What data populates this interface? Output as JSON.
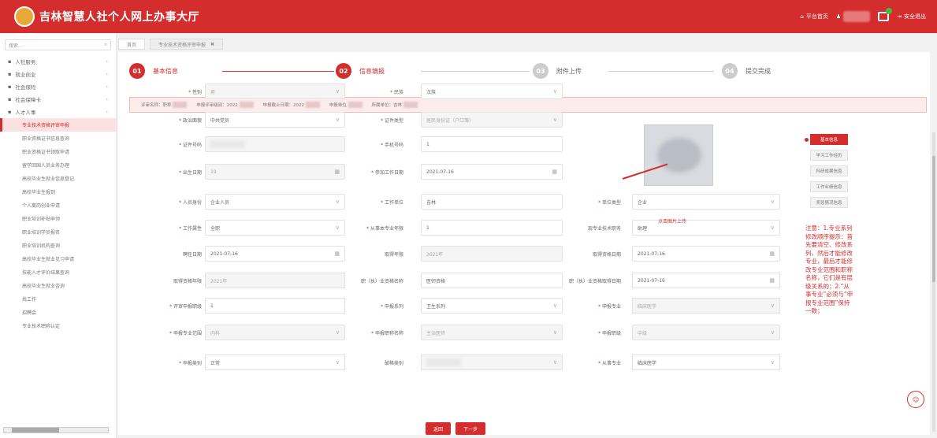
{
  "header": {
    "title": "吉林智慧人社个人网上办事大厅",
    "home_label": "平台首页",
    "logout_label": "安全退出"
  },
  "sidebar": {
    "search_placeholder": "搜索...",
    "groups": [
      {
        "label": "人社服务"
      },
      {
        "label": "就业创业"
      },
      {
        "label": "社会保险"
      },
      {
        "label": "社会保障卡"
      },
      {
        "label": "人才人事"
      }
    ],
    "sub_items": [
      {
        "label": "专业技术资格评审申报"
      },
      {
        "label": "职业资格证书信息查询"
      },
      {
        "label": "职业资格证书领取申请"
      },
      {
        "label": "留学回国人员业务办理"
      },
      {
        "label": "高校毕业生就业信息登记"
      },
      {
        "label": "高校毕业生报到"
      },
      {
        "label": "个人离岗创业申请"
      },
      {
        "label": "职业培训补贴申领"
      },
      {
        "label": "职业培训学员报名"
      },
      {
        "label": "职业培训机构查询"
      },
      {
        "label": "高校毕业生就业见习申请"
      },
      {
        "label": "技能人才评价结果查询"
      },
      {
        "label": "高校毕业生就业咨询"
      },
      {
        "label": "找工作"
      },
      {
        "label": "招聘会"
      },
      {
        "label": "专业技术职称认定"
      }
    ]
  },
  "tabs": [
    {
      "label": "首页"
    },
    {
      "label": "专业技术资格评审申报"
    }
  ],
  "steps": [
    {
      "num": "01",
      "label": "基本信息"
    },
    {
      "num": "02",
      "label": "信息填报"
    },
    {
      "num": "03",
      "label": "附件上传"
    },
    {
      "num": "04",
      "label": "提交完成"
    }
  ],
  "infobar": {
    "items": [
      "评审名称：职称",
      "申报评审级别：2022",
      "申报截止日期：2022",
      "申报单位",
      "所属单位：吉林"
    ]
  },
  "form": {
    "fields": [
      {
        "label": "性别",
        "value": "男",
        "required": true,
        "disabled": true,
        "suffix": "∨"
      },
      {
        "label": "民族",
        "value": "汉族",
        "required": true,
        "disabled": false,
        "suffix": "∨"
      },
      {
        "label": "政治面貌",
        "value": "中共党员",
        "required": true,
        "disabled": false,
        "suffix": "∨"
      },
      {
        "label": "证件类型",
        "value": "居民身份证（户口簿）",
        "required": true,
        "disabled": true,
        "suffix": "∨"
      },
      {
        "label": "证件号码",
        "value": "",
        "required": true,
        "disabled": true,
        "suffix": ""
      },
      {
        "label": "手机号码",
        "value": "1",
        "required": true,
        "disabled": false,
        "suffix": ""
      },
      {
        "label": "出生日期",
        "value": "19",
        "required": true,
        "disabled": true,
        "suffix": "▦"
      },
      {
        "label": "参加工作日期",
        "value": "2021-07-16",
        "required": true,
        "disabled": false,
        "suffix": "▦"
      },
      {
        "label": "人员身份",
        "value": "企业人员",
        "required": true,
        "disabled": false,
        "suffix": "∨"
      },
      {
        "label": "工作单位",
        "value": "吉林",
        "required": true,
        "disabled": false,
        "suffix": ""
      },
      {
        "label": "单位类型",
        "value": "企业",
        "required": true,
        "disabled": false,
        "suffix": "∨"
      },
      {
        "label": "工作属性",
        "value": "全职",
        "required": true,
        "disabled": false,
        "suffix": "∨"
      },
      {
        "label": "从事本专业年限",
        "value": "1",
        "required": true,
        "disabled": false,
        "suffix": ""
      },
      {
        "label": "现专业技术职务",
        "value": "助理",
        "required": false,
        "disabled": false,
        "suffix": "∨"
      },
      {
        "label": "聘任日期",
        "value": "2021-07-16",
        "required": false,
        "disabled": false,
        "suffix": "▦"
      },
      {
        "label": "取得年限",
        "value": "2021年",
        "required": false,
        "disabled": true,
        "suffix": ""
      },
      {
        "label": "取得资格日期",
        "value": "2021-07-16",
        "required": false,
        "disabled": false,
        "suffix": "▦"
      },
      {
        "label": "取得资格年限",
        "value": "2021年",
        "required": false,
        "disabled": true,
        "suffix": ""
      },
      {
        "label": "职（执）业资格名称",
        "value": "医师资格",
        "required": false,
        "disabled": false,
        "suffix": ""
      },
      {
        "label": "职（执）业资格取得日期",
        "value": "2021-07-16",
        "required": false,
        "disabled": false,
        "suffix": "▦"
      },
      {
        "label": "评审申报职级",
        "value": "1",
        "required": true,
        "disabled": false,
        "suffix": ""
      },
      {
        "label": "申报系列",
        "value": "卫生系列",
        "required": true,
        "disabled": false,
        "suffix": "∨"
      },
      {
        "label": "申报专业",
        "value": "临床医学",
        "required": true,
        "disabled": true,
        "suffix": "∨"
      },
      {
        "label": "申报专业范围",
        "value": "内科",
        "required": true,
        "disabled": true,
        "suffix": "∨"
      },
      {
        "label": "申报职称名称",
        "value": "主治医师",
        "required": true,
        "disabled": true,
        "suffix": "∨"
      },
      {
        "label": "申报职级",
        "value": "中级",
        "required": true,
        "disabled": true,
        "suffix": "∨"
      },
      {
        "label": "申报类别",
        "value": "正常",
        "required": true,
        "disabled": false,
        "suffix": "∨"
      },
      {
        "label": "破格类别",
        "value": "",
        "required": false,
        "disabled": true,
        "suffix": "∨"
      },
      {
        "label": "从事专业",
        "value": "临床医学",
        "required": true,
        "disabled": false,
        "suffix": "∨"
      }
    ]
  },
  "photo": {
    "upload_link": "点击图片上传"
  },
  "buttons": {
    "prev_label": "返回",
    "next_label": "下一步"
  },
  "right_nav": {
    "items": [
      {
        "label": "基本信息"
      },
      {
        "label": "学习工作经历"
      },
      {
        "label": "科研成果信息"
      },
      {
        "label": "工作业绩信息"
      },
      {
        "label": "奖惩情况信息"
      }
    ]
  },
  "note": "注意：1.专业系列修改顺序提示：首先要清空、修改系列，然后才能修改专业，最后才能修改专业范围和职称名称，它们是有层级关系的；2.“从事专业”必须与“申报专业范围”保持一致；",
  "colors": {
    "brand": "#d42d2d",
    "step_todo": "#cccccc"
  }
}
